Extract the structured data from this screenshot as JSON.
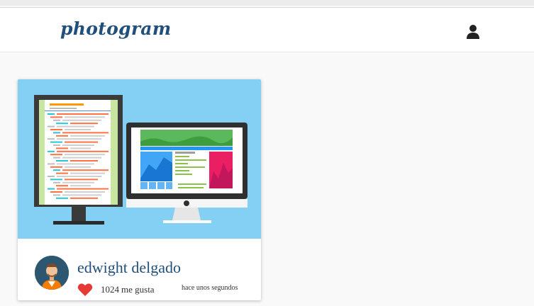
{
  "app": {
    "brand": "photogram"
  },
  "header": {
    "user_icon": "user-icon"
  },
  "post": {
    "image_description_icon": "developer-monitors-illustration",
    "author": "edwight delgado",
    "likes_count": "1024",
    "likes_label": "me gusta",
    "timestamp": "hace unos segundos",
    "like_icon": "heart-icon",
    "colors": {
      "accent": "#1f4f7a",
      "heart": "#e53935",
      "image_bg": "#84cff4"
    }
  }
}
